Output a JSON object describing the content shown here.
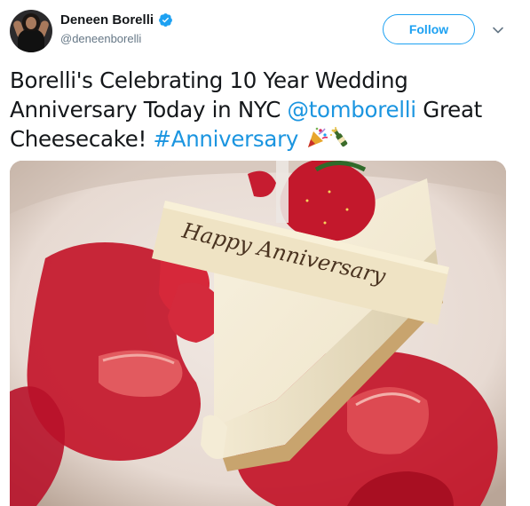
{
  "author": {
    "display_name": "Deneen Borelli",
    "handle": "@deneenborelli",
    "verified": true
  },
  "actions": {
    "follow_label": "Follow",
    "menu_icon": "chevron-down-icon"
  },
  "tweet": {
    "text_part1": "Borelli's Celebrating 10 Year Wedding Anniversary Today in NYC ",
    "mention": "@tomborelli",
    "text_part2": " Great Cheesecake! ",
    "hashtag": "#Anniversary",
    "emojis": [
      "party-popper-icon",
      "champagne-icon"
    ]
  },
  "media": {
    "plaque_text": "Happy Anniversary"
  },
  "colors": {
    "link": "#1b95e0",
    "follow": "#1da1f2",
    "verified": "#1da1f2",
    "handle": "#657786"
  }
}
